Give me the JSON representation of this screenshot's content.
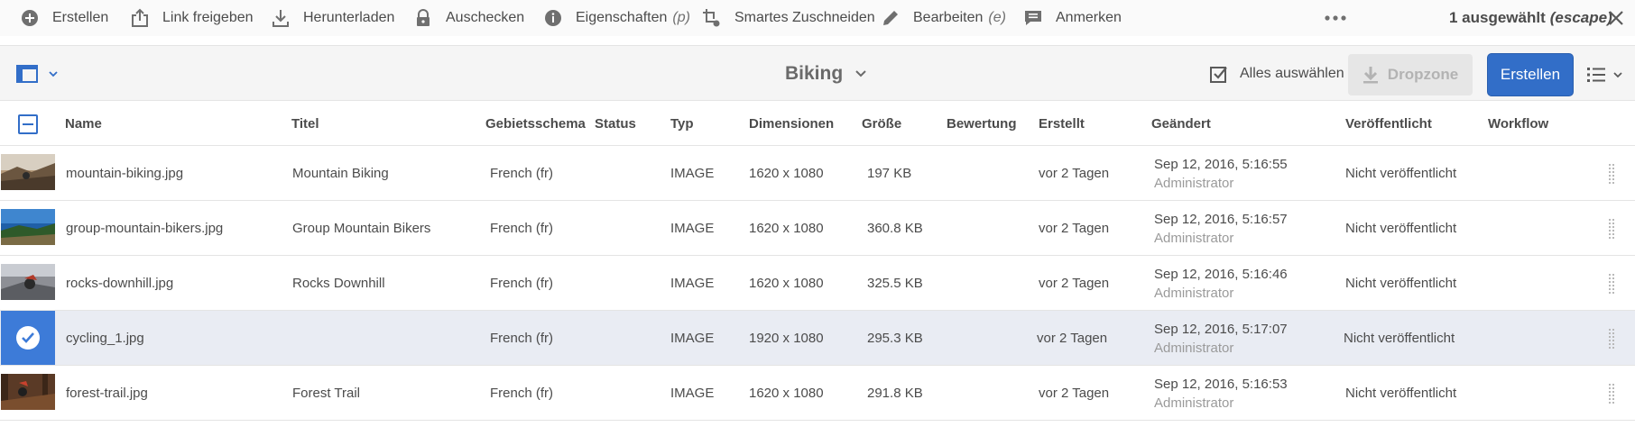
{
  "actionbar": {
    "items": [
      {
        "label": "Erstellen",
        "icon": "add-circle-icon",
        "shortcut": ""
      },
      {
        "label": "Link freigeben",
        "icon": "share-icon",
        "shortcut": ""
      },
      {
        "label": "Herunterladen",
        "icon": "download-icon",
        "shortcut": ""
      },
      {
        "label": "Auschecken",
        "icon": "lock-icon",
        "shortcut": ""
      },
      {
        "label": "Eigenschaften",
        "icon": "info-icon",
        "shortcut": "(p)"
      },
      {
        "label": "Smartes Zuschneiden",
        "icon": "crop-icon",
        "shortcut": ""
      },
      {
        "label": "Bearbeiten",
        "icon": "pencil-icon",
        "shortcut": "(e)"
      },
      {
        "label": "Anmerken",
        "icon": "comment-icon",
        "shortcut": ""
      }
    ],
    "more_icon": "more-icon",
    "selection_count": "1 ausgewählt",
    "escape_hint": "(escape)"
  },
  "header": {
    "folder_title": "Biking",
    "select_all_label": "Alles auswählen",
    "dropzone_label": "Dropzone",
    "create_label": "Erstellen"
  },
  "table": {
    "columns": [
      "Name",
      "Titel",
      "Gebietsschema",
      "Status",
      "Typ",
      "Dimensionen",
      "Größe",
      "Bewertung",
      "Erstellt",
      "Geändert",
      "Veröffentlicht",
      "Workflow"
    ],
    "rows": [
      {
        "name": "mountain-biking.jpg",
        "title": "Mountain Biking",
        "locale": "French (fr)",
        "status": "",
        "type": "IMAGE",
        "dimensions": "1620 x 1080",
        "size": "197 KB",
        "rating": "",
        "created": "vor 2 Tagen",
        "modified": "Sep 12, 2016, 5:16:55",
        "modified_by": "Administrator",
        "published": "Nicht veröffentlicht",
        "workflow": "",
        "selected": false
      },
      {
        "name": "group-mountain-bikers.jpg",
        "title": "Group Mountain Bikers",
        "locale": "French (fr)",
        "status": "",
        "type": "IMAGE",
        "dimensions": "1620 x 1080",
        "size": "360.8 KB",
        "rating": "",
        "created": "vor 2 Tagen",
        "modified": "Sep 12, 2016, 5:16:57",
        "modified_by": "Administrator",
        "published": "Nicht veröffentlicht",
        "workflow": "",
        "selected": false
      },
      {
        "name": "rocks-downhill.jpg",
        "title": "Rocks Downhill",
        "locale": "French (fr)",
        "status": "",
        "type": "IMAGE",
        "dimensions": "1620 x 1080",
        "size": "325.5 KB",
        "rating": "",
        "created": "vor 2 Tagen",
        "modified": "Sep 12, 2016, 5:16:46",
        "modified_by": "Administrator",
        "published": "Nicht veröffentlicht",
        "workflow": "",
        "selected": false
      },
      {
        "name": "cycling_1.jpg",
        "title": "",
        "locale": "French (fr)",
        "status": "",
        "type": "IMAGE",
        "dimensions": "1920 x 1080",
        "size": "295.3 KB",
        "rating": "",
        "created": "vor 2 Tagen",
        "modified": "Sep 12, 2016, 5:17:07",
        "modified_by": "Administrator",
        "published": "Nicht veröffentlicht",
        "workflow": "",
        "selected": true
      },
      {
        "name": "forest-trail.jpg",
        "title": "Forest Trail",
        "locale": "French (fr)",
        "status": "",
        "type": "IMAGE",
        "dimensions": "1620 x 1080",
        "size": "291.8 KB",
        "rating": "",
        "created": "vor 2 Tagen",
        "modified": "Sep 12, 2016, 5:16:53",
        "modified_by": "Administrator",
        "published": "Nicht veröffentlicht",
        "workflow": "",
        "selected": false
      }
    ]
  },
  "colors": {
    "accent": "#326ec8",
    "selected_row": "#e9ecf3",
    "check_overlay": "#3d7bd8",
    "muted_text": "#9a9a9a"
  }
}
